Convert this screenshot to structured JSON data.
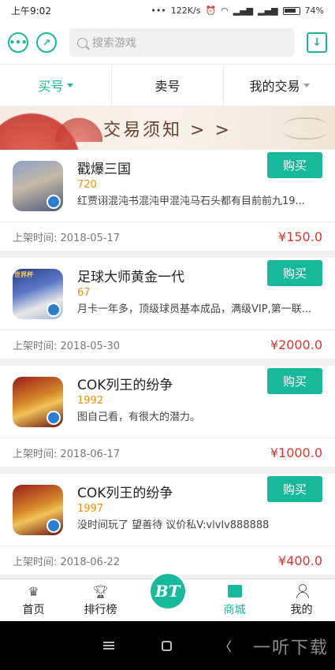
{
  "status_bar": {
    "time": "上午9:02",
    "dots": "•••",
    "speed": "122K/s",
    "battery": "74%"
  },
  "header": {
    "search_placeholder": "搜索游戏"
  },
  "tabs": [
    {
      "label": "买号",
      "active": true
    },
    {
      "label": "卖号",
      "active": false
    },
    {
      "label": "我的交易",
      "active": false
    }
  ],
  "banner": {
    "text": "交易须知 > >"
  },
  "listings": [
    {
      "name": "戳爆三国",
      "number": "720",
      "description": "红贾诩混沌书混沌甲混沌马石头都有目前前九19...",
      "buy_label": "购买",
      "date": "上架时间: 2018-05-17",
      "price": "¥150.0",
      "icon": "three-kingdoms-game-icon"
    },
    {
      "name": "足球大师黄金一代",
      "number": "67",
      "description": "月卡一年多，顶级球员基本成品，满级VIP,第一联...",
      "buy_label": "购买",
      "date": "上架时间: 2018-05-30",
      "price": "¥2000.0",
      "icon": "football-master-game-icon",
      "icon_text": "世界杯"
    },
    {
      "name": "COK列王的纷争",
      "number": "1992",
      "description": "图自己看，有很大的潜力。",
      "buy_label": "购买",
      "date": "上架时间: 2018-06-17",
      "price": "¥1000.0",
      "icon": "cok-game-icon"
    },
    {
      "name": "COK列王的纷争",
      "number": "1997",
      "description": "没时间玩了 望善待 议价私V:vlvlv888888",
      "buy_label": "购买",
      "date": "上架时间: 2018-06-22",
      "price": "¥400.0",
      "icon": "cok-game-icon"
    }
  ],
  "bottom_nav": [
    {
      "label": "首页",
      "icon": "crown-icon",
      "active": false
    },
    {
      "label": "排行榜",
      "icon": "trophy-icon",
      "active": false
    },
    {
      "label": "BT",
      "icon": "bt-icon",
      "active": false
    },
    {
      "label": "商城",
      "icon": "shopping-bag-icon",
      "active": true
    },
    {
      "label": "我的",
      "icon": "person-icon",
      "active": false
    }
  ],
  "watermark": "一听下载",
  "colors": {
    "accent": "#17b99a",
    "price": "#e0352b",
    "number": "#f0900f"
  }
}
